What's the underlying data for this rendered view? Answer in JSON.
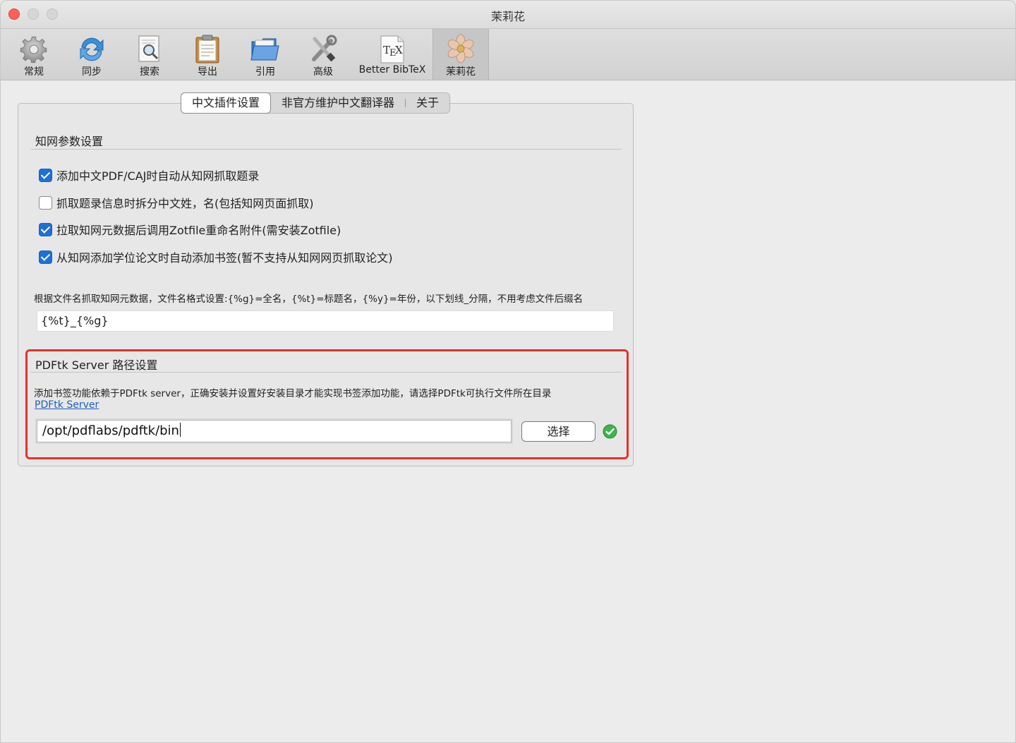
{
  "window": {
    "title": "茉莉花"
  },
  "toolbar": {
    "items": [
      {
        "label": "常规",
        "icon": "gear-icon"
      },
      {
        "label": "同步",
        "icon": "sync-icon"
      },
      {
        "label": "搜索",
        "icon": "search-icon"
      },
      {
        "label": "导出",
        "icon": "clipboard-icon"
      },
      {
        "label": "引用",
        "icon": "folder-icon"
      },
      {
        "label": "高级",
        "icon": "tools-icon"
      },
      {
        "label": "Better BibTeX",
        "icon": "tex-icon"
      },
      {
        "label": "茉莉花",
        "icon": "flower-icon",
        "active": true
      }
    ]
  },
  "tabs": [
    {
      "label": "中文插件设置",
      "selected": true
    },
    {
      "label": "非官方维护中文翻译器"
    },
    {
      "label": "关于"
    }
  ],
  "cnki": {
    "section_title": "知网参数设置",
    "options": [
      {
        "label": "添加中文PDF/CAJ时自动从知网抓取题录",
        "checked": true
      },
      {
        "label": "抓取题录信息时拆分中文姓，名(包括知网页面抓取)",
        "checked": false
      },
      {
        "label": "拉取知网元数据后调用Zotfile重命名附件(需安装Zotfile)",
        "checked": true
      },
      {
        "label": "从知网添加学位论文时自动添加书签(暂不支持从知网网页抓取论文)",
        "checked": true
      }
    ],
    "filename_hint": "根据文件名抓取知网元数据，文件名格式设置:{%g}=全名，{%t}=标题名，{%y}=年份，以下划线_分隔，不用考虑文件后缀名",
    "filename_pattern": "{%t}_{%g}"
  },
  "pdftk": {
    "section_title": "PDFtk Server 路径设置",
    "description": "添加书签功能依赖于PDFtk server，正确安装并设置好安装目录才能实现书签添加功能，请选择PDFtk可执行文件所在目录",
    "link_label": "PDFtk Server",
    "path_value": "/opt/pdflabs/pdftk/bin",
    "choose_label": "选择",
    "status_icon": "check-circle-icon"
  },
  "colors": {
    "accent": "#1e6fd9",
    "highlight_frame": "#e6322e",
    "ok": "#3fb34f",
    "link": "#1f5fbf"
  }
}
